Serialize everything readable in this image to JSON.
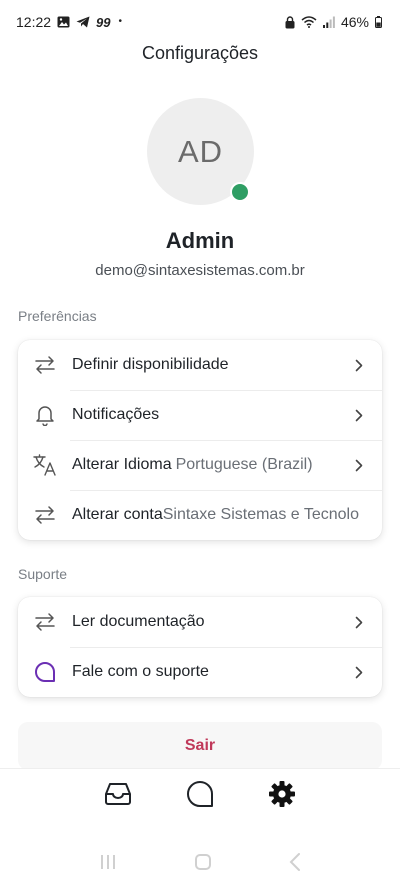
{
  "status_bar": {
    "time": "12:22",
    "badge": "99",
    "dot": "•",
    "battery": "46%",
    "icons": [
      "gallery-icon",
      "telegram-icon",
      "lock-icon",
      "wifi-icon",
      "signal-icon",
      "battery-icon"
    ]
  },
  "header": {
    "title": "Configurações"
  },
  "profile": {
    "initials": "AD",
    "name": "Admin",
    "email": "demo@sintaxesistemas.com.br",
    "online_color": "#2f9e64"
  },
  "preferences": {
    "label": "Preferências",
    "items": [
      {
        "icon": "swap-arrows-icon",
        "label": "Definir disponibilidade",
        "value": ""
      },
      {
        "icon": "bell-icon",
        "label": "Notificações",
        "value": ""
      },
      {
        "icon": "translate-icon",
        "label": "Alterar Idioma",
        "value": "Portuguese (Brazil)"
      },
      {
        "icon": "swap-arrows-icon",
        "label": "Alterar conta",
        "value": "Sintaxe Sistemas e Tecnolo"
      }
    ]
  },
  "support": {
    "label": "Suporte",
    "items": [
      {
        "icon": "swap-arrows-icon",
        "label": "Ler documentação"
      },
      {
        "icon": "chat-bubble-icon",
        "label": "Fale com o suporte"
      }
    ]
  },
  "logout": {
    "label": "Sair",
    "color": "#c0395a"
  },
  "bottom_nav": {
    "items": [
      "inbox-icon",
      "chat-icon",
      "settings-icon"
    ],
    "active": "settings-icon"
  },
  "system_nav": [
    "recents-icon",
    "home-icon",
    "back-icon"
  ],
  "colors": {
    "accent_purple": "#6b2fb3",
    "text": "#1f2328",
    "muted": "#7a7f86"
  }
}
